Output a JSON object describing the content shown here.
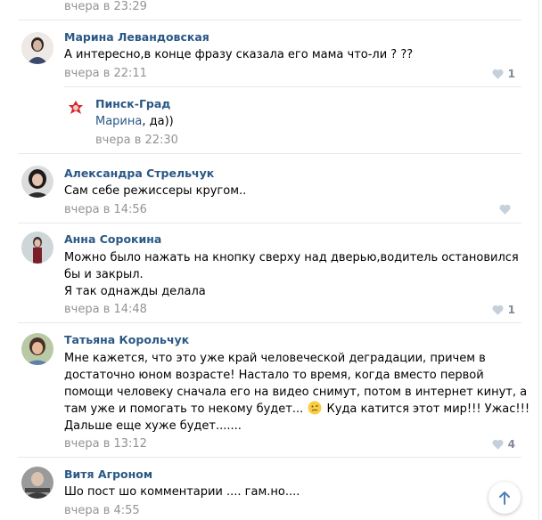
{
  "comments": [
    {
      "date": "вчера в 23:29"
    },
    {
      "author": "Марина Левандовская",
      "lines": [
        "А интересно,в конце фразу сказала его мама что-ли ? ??"
      ],
      "date": "вчера в 22:11",
      "likes": "1"
    },
    {
      "author": "Пинск-Град",
      "reply_to": "Марина",
      "reply_text": ", да))",
      "date": "вчера в 22:30"
    },
    {
      "author": "Александра Стрельчук",
      "lines": [
        "Сам себе режиссеры кругом.."
      ],
      "date": "вчера в 14:56",
      "likes": ""
    },
    {
      "author": "Анна Сорокина",
      "lines": [
        "Можно было нажать на кнопку сверху над дверью,водитель остановился",
        "бы и закрыл.",
        "Я так однажды делала"
      ],
      "date": "вчера в 14:48",
      "likes": "1"
    },
    {
      "author": "Татьяна Корольчук",
      "lines": [
        "Мне кажется, что это уже край человеческой деградации, причем в",
        "достаточно юном возрасте! Настало то время, когда вместо первой",
        "помощи человеку сначала его на видео снимут, потом в интернет кинут, а",
        "там уже и помогать то некому будет...",
        "Куда катится этот мир!!! Ужас!!!",
        "Дальше еще хуже будет......."
      ],
      "date": "вчера в 13:12",
      "likes": "4"
    },
    {
      "author": "Витя Агроном",
      "lines": [
        "Шо пост шо комментарии .... гам.но...."
      ],
      "date": "вчера в 4:55"
    }
  ],
  "icons": {
    "like": "heart-icon",
    "emoji": "thinking-face-emoji",
    "scroll": "arrow-up-icon"
  },
  "colors": {
    "author": "#2a5885",
    "meta": "#939393",
    "separator": "#e7e8ec",
    "like_icon": "#c5d0db"
  }
}
